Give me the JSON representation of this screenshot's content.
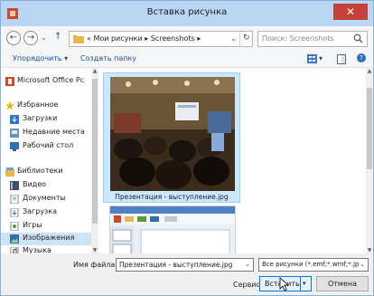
{
  "window": {
    "title": "Вставка рисунка",
    "close_glyph": "✕"
  },
  "nav": {
    "back_glyph": "←",
    "forward_glyph": "→",
    "history_glyph": "⌄",
    "up_glyph": "↑",
    "breadcrumb": "« Мои рисунки ▸ Screenshots ▸",
    "address_dropdown_glyph": "⌄",
    "refresh_glyph": "↻",
    "search_placeholder": "Поиск: Screenshots"
  },
  "toolbar": {
    "organize_label": "Упорядочить ▾",
    "new_folder_label": "Создать папку",
    "view_dropdown_glyph": "▾",
    "help_glyph": "?"
  },
  "sidebar": {
    "items": [
      {
        "label": "Microsoft Office Pc",
        "icon": "office-icon"
      },
      {
        "label": "Избранное",
        "icon": "star-icon"
      },
      {
        "label": "Загрузки",
        "icon": "downloads-icon"
      },
      {
        "label": "Недавние места",
        "icon": "recent-places-icon"
      },
      {
        "label": "Рабочий стол",
        "icon": "desktop-icon"
      },
      {
        "label": "Библиотеки",
        "icon": "libraries-icon"
      },
      {
        "label": "Видео",
        "icon": "video-icon"
      },
      {
        "label": "Документы",
        "icon": "documents-icon"
      },
      {
        "label": "Загрузка",
        "icon": "download-library-icon"
      },
      {
        "label": "Игры",
        "icon": "games-icon"
      },
      {
        "label": "Изображения",
        "icon": "pictures-icon"
      },
      {
        "label": "Музыка",
        "icon": "music-icon"
      }
    ],
    "selected_index": 10
  },
  "content": {
    "selected_file_caption": "Презентация - выступление.jpg"
  },
  "bottom": {
    "filename_label": "Имя файла:",
    "filename_value": "Презентация - выступление.jpg",
    "filename_dropdown_glyph": "⌄",
    "filter_value": "Все рисунки (*.emf;*.wmf;*.jp",
    "filter_dropdown_glyph": "⌄",
    "service_label": "Сервис ▾",
    "insert_label": "Вставить",
    "insert_dropdown_glyph": "▾",
    "cancel_label": "Отмена"
  },
  "colors": {
    "titlebar": "#b9d6f2",
    "selection": "#cce8ff",
    "accent": "#0078d7",
    "close": "#c7413b"
  }
}
